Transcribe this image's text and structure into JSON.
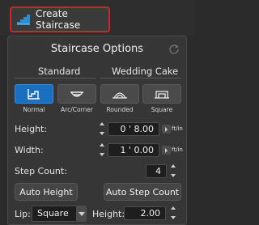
{
  "toolbar": {
    "create_label": "Create Staircase"
  },
  "panel": {
    "title": "Staircase Options",
    "groups": {
      "standard": "Standard",
      "wedding_cake": "Wedding Cake"
    },
    "types": [
      {
        "label": "Normal",
        "active": true
      },
      {
        "label": "Arc/Corner",
        "active": false
      },
      {
        "label": "Rounded",
        "active": false
      },
      {
        "label": "Square",
        "active": false
      }
    ],
    "height": {
      "label": "Height:",
      "value": "0 ' 8.00",
      "unit": "ft/in"
    },
    "width": {
      "label": "Width:",
      "value": "1 ' 0.00",
      "unit": "ft/in"
    },
    "step_count": {
      "label": "Step Count:",
      "value": "4"
    },
    "buttons": {
      "auto_height": "Auto Height",
      "auto_step_count": "Auto Step Count"
    },
    "lip": {
      "label": "Lip:",
      "value": "Square"
    },
    "lip_height": {
      "label": "Height:",
      "value": "2.00"
    }
  },
  "colors": {
    "accent": "#1a6fbf",
    "highlight": "#d8202a",
    "icon": "#2a8fd6"
  }
}
